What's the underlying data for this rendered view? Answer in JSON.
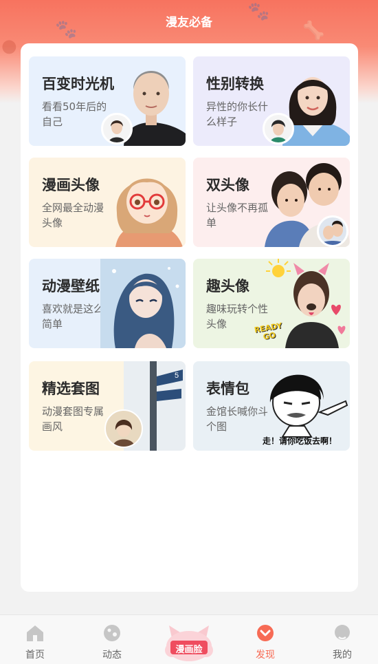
{
  "header": {
    "title": "漫友必备"
  },
  "cards": [
    {
      "title": "百变时光机",
      "subtitle": "看看50年后的自己",
      "icon": "aging-portrait-image"
    },
    {
      "title": "性别转换",
      "subtitle": "异性的你长什么样子",
      "icon": "gender-swap-portrait-image"
    },
    {
      "title": "漫画头像",
      "subtitle": "全网最全动漫头像",
      "icon": "anime-avatar-image"
    },
    {
      "title": "双头像",
      "subtitle": "让头像不再孤单",
      "icon": "couple-avatar-image"
    },
    {
      "title": "动漫壁纸",
      "subtitle": "喜欢就是这么简单",
      "icon": "anime-wallpaper-image"
    },
    {
      "title": "趣头像",
      "subtitle": "趣味玩转个性头像",
      "icon": "fun-avatar-image",
      "badge": "READY GO"
    },
    {
      "title": "精选套图",
      "subtitle": "动漫套图专属画风",
      "icon": "picture-set-image"
    },
    {
      "title": "表情包",
      "subtitle": "金馆长喊你斗个图",
      "icon": "meme-image",
      "caption": "走！请你吃饭去啊！"
    }
  ],
  "colors": {
    "accent": "#f76b55",
    "card_bgs": [
      "#e8f1fd",
      "#ecebfb",
      "#fdf3e2",
      "#fdeeee",
      "#e7f0fb",
      "#edf5e3",
      "#fdf5e3",
      "#e9f0f5"
    ]
  },
  "tabbar": {
    "items": [
      {
        "label": "首页",
        "icon": "home-icon"
      },
      {
        "label": "动态",
        "icon": "planet-icon"
      },
      {
        "label": "发现",
        "icon": "discover-icon",
        "active": true
      },
      {
        "label": "我的",
        "icon": "profile-icon"
      }
    ],
    "center_label": "漫画脸"
  }
}
